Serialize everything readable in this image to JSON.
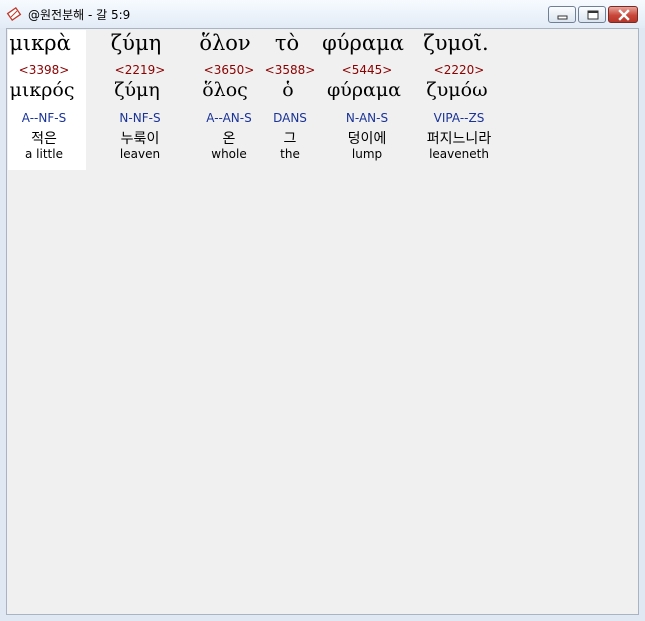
{
  "window": {
    "title": "@원전분해 - 갈 5:9",
    "icons": {
      "app": "app-icon",
      "minimize": "minimize-icon",
      "maximize": "maximize-icon",
      "close": "close-icon"
    }
  },
  "words": [
    {
      "greek": "μικρὰ",
      "strong": "<3398>",
      "lemma": "μικρός",
      "parse": "A--NF-S",
      "korean": "적은",
      "english": "a little"
    },
    {
      "greek": "ζύμη",
      "strong": "<2219>",
      "lemma": "ζύμη",
      "parse": "N-NF-S",
      "korean": "누룩이",
      "english": "leaven"
    },
    {
      "greek": "ὅλον",
      "strong": "<3650>",
      "lemma": "ὅλος",
      "parse": "A--AN-S",
      "korean": "온",
      "english": "whole"
    },
    {
      "greek": "τὸ",
      "strong": "<3588>",
      "lemma": "ὁ",
      "parse": "DANS",
      "korean": "그",
      "english": "the"
    },
    {
      "greek": "φύραμα",
      "strong": "<5445>",
      "lemma": "φύραμα",
      "parse": "N-AN-S",
      "korean": "덩이에",
      "english": "lump"
    },
    {
      "greek": "ζυμοῖ.",
      "strong": "<2220>",
      "lemma": "ζυμόω",
      "parse": "VIPA--ZS",
      "korean": "퍼지느니라",
      "english": "leaveneth"
    }
  ],
  "colors": {
    "strong": "#8b0000",
    "parse": "#1a3399",
    "highlight": "#ffffff"
  }
}
